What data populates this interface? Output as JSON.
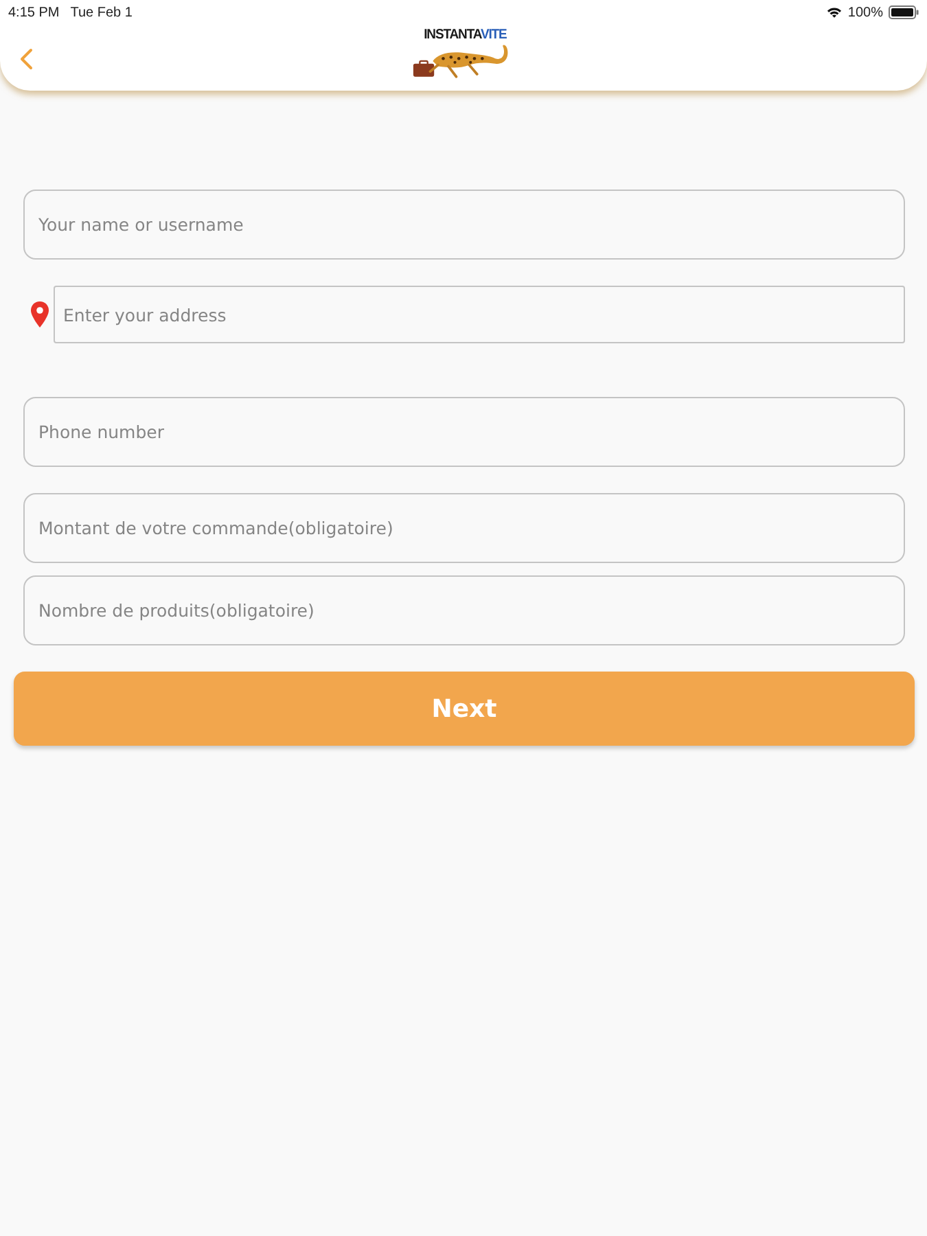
{
  "status_bar": {
    "time": "4:15 PM",
    "date": "Tue Feb 1",
    "battery": "100%"
  },
  "header": {
    "logo": {
      "wordmark": [
        "INSTANTA",
        "VITE"
      ]
    }
  },
  "form": {
    "fields": [
      {
        "kind": "text",
        "placeholder": "Your name or username"
      },
      {
        "kind": "address",
        "placeholder": "Enter your address"
      },
      {
        "kind": "text",
        "placeholder": "Phone number"
      }
    ],
    "order_fields": [
      {
        "kind": "text",
        "placeholder": "Montant de votre commande(obligatoire)"
      },
      {
        "kind": "text",
        "placeholder": "Nombre de produits(obligatoire)"
      }
    ],
    "submit": "Next"
  }
}
